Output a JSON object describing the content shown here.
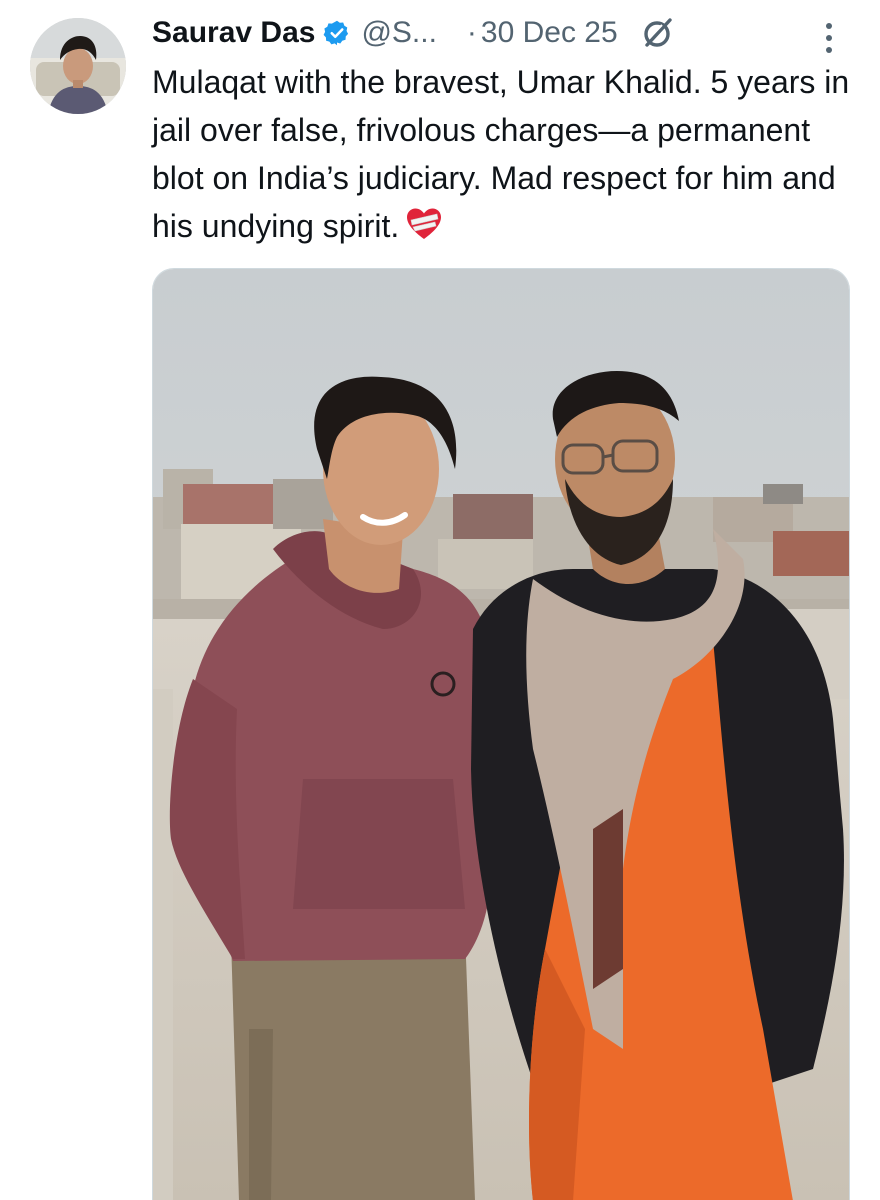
{
  "tweet": {
    "author_name": "Saurav Das",
    "handle": "@S...",
    "separator": "·",
    "date": "30 Dec 25",
    "text": "Mulaqat with the bravest, Umar Khalid. 5 years in jail over false, frivolous charges—a permanent blot on India’s judiciary. Mad respect for him and his undying spirit."
  },
  "icons": {
    "verified": "verified-badge-icon",
    "grok": "grok-icon",
    "more": "more-options-icon",
    "emoji": "mending-heart-emoji"
  },
  "colors": {
    "text_primary": "#0f1419",
    "text_secondary": "#536471",
    "verified_blue": "#1d9bf0"
  }
}
